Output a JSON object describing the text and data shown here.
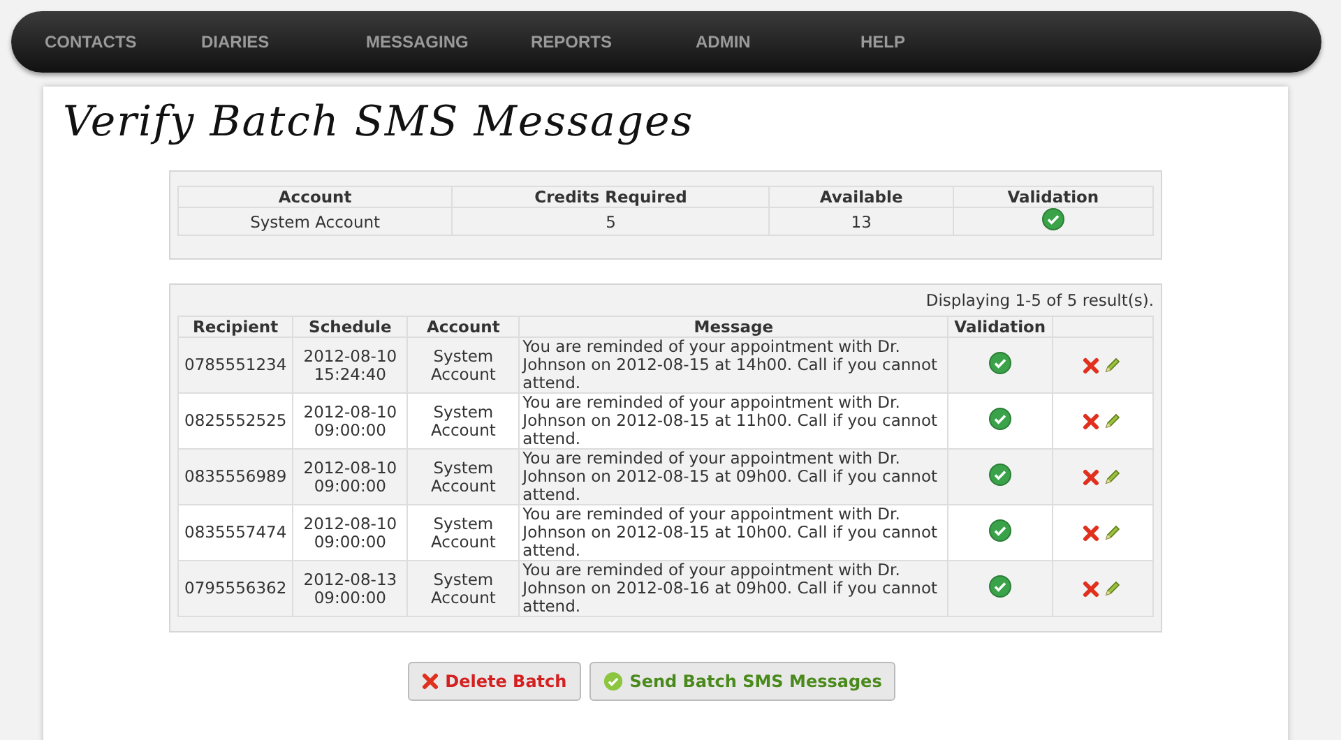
{
  "nav": [
    {
      "label": "CONTACTS"
    },
    {
      "label": "DIARIES"
    },
    {
      "label": "MESSAGING"
    },
    {
      "label": "REPORTS"
    },
    {
      "label": "ADMIN"
    },
    {
      "label": "HELP"
    }
  ],
  "title": "Verify Batch SMS Messages",
  "summary": {
    "columns": [
      "Account",
      "Credits Required",
      "Available",
      "Validation"
    ],
    "row": {
      "account": "System Account",
      "credits": "5",
      "available": "13",
      "valid": true
    }
  },
  "results": {
    "count_text": "Displaying 1-5 of 5 result(s).",
    "columns": [
      "Recipient",
      "Schedule",
      "Account",
      "Message",
      "Validation"
    ],
    "rows": [
      {
        "recipient": "0785551234",
        "date": "2012-08-10",
        "time": "15:24:40",
        "account": "System Account",
        "message": "You are reminded of your appointment with Dr. Johnson on 2012-08-15 at 14h00. Call if you cannot attend.",
        "valid": true
      },
      {
        "recipient": "0825552525",
        "date": "2012-08-10",
        "time": "09:00:00",
        "account": "System Account",
        "message": "You are reminded of your appointment with Dr. Johnson on 2012-08-15 at 11h00. Call if you cannot attend.",
        "valid": true
      },
      {
        "recipient": "0835556989",
        "date": "2012-08-10",
        "time": "09:00:00",
        "account": "System Account",
        "message": "You are reminded of your appointment with Dr. Johnson on 2012-08-15 at 09h00. Call if you cannot attend.",
        "valid": true
      },
      {
        "recipient": "0835557474",
        "date": "2012-08-10",
        "time": "09:00:00",
        "account": "System Account",
        "message": "You are reminded of your appointment with Dr. Johnson on 2012-08-15 at 10h00. Call if you cannot attend.",
        "valid": true
      },
      {
        "recipient": "0795556362",
        "date": "2012-08-13",
        "time": "09:00:00",
        "account": "System Account",
        "message": "You are reminded of your appointment with Dr. Johnson on 2012-08-16 at 09h00. Call if you cannot attend.",
        "valid": true
      }
    ]
  },
  "buttons": [
    {
      "label": "Delete Batch",
      "kind": "delete"
    },
    {
      "label": "Send Batch SMS Messages",
      "kind": "send"
    }
  ]
}
